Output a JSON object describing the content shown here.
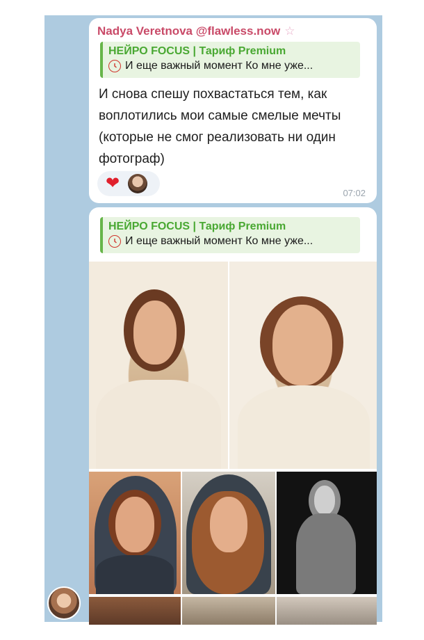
{
  "message1": {
    "sender_name": "Nadya Veretnova @flawless.now",
    "sender_badge": "☆",
    "reply": {
      "title": "НЕЙРО FOCUS | Тариф Premium",
      "text": "И еще важный момент Ко мне уже..."
    },
    "text": "И снова спешу похвастаться тем, как воплотились мои самые смелые мечты (которые не смог реализовать ни один фотограф)",
    "reactions": {
      "emoji": "❤",
      "reactor_avatar": "user-avatar"
    },
    "time": "07:02"
  },
  "message2": {
    "reply": {
      "title": "НЕЙРО FOCUS | Тариф Premium",
      "text": "И еще важный момент Ко мне уже..."
    },
    "photos": [
      {
        "subject": "woman in cream headscarf"
      },
      {
        "subject": "woman in cream headscarf close-up"
      },
      {
        "subject": "woman in dark patterned headscarf"
      },
      {
        "subject": "woman in dark patterned headscarf with loose hair"
      },
      {
        "subject": "black and white portrait woman in blazer"
      }
    ]
  },
  "colors": {
    "chat_background": "#aecbe0",
    "sender_name": "#c94a68",
    "reply_accent": "#67b54a",
    "reply_background": "#e8f4e1",
    "reaction_heart": "#e0202c",
    "time": "#9aa4ad"
  },
  "icons": {
    "reply_icon": "timer-circle-icon",
    "badge_icon": "star-icon"
  }
}
